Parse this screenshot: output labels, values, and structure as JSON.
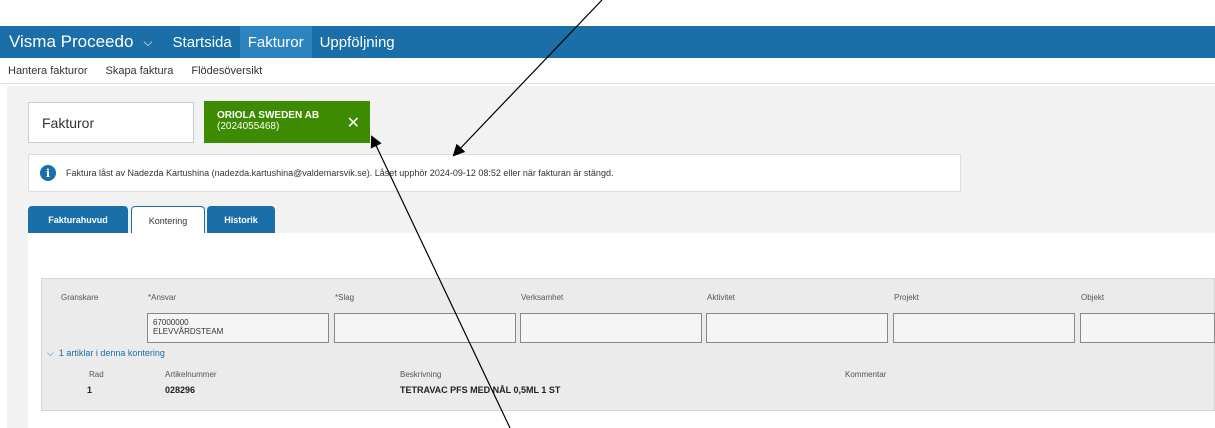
{
  "header": {
    "app_name": "Visma Proceedo",
    "nav": [
      "Startsida",
      "Fakturor",
      "Uppföljning"
    ]
  },
  "subnav": [
    "Hantera fakturor",
    "Skapa faktura",
    "Flödesöversikt"
  ],
  "invoice_box": {
    "label": "Fakturor"
  },
  "supplier_tag": {
    "name": "ORIOLA SWEDEN AB",
    "number": "(2024055468)"
  },
  "info_message": "Faktura låst av Nadezda Kartushina (nadezda.kartushina@valdemarsvik.se). Låset upphör 2024-09-12 08:52 eller när fakturan är stängd.",
  "tabs": [
    "Fakturahuvud",
    "Kontering",
    "Historik"
  ],
  "kontering": {
    "columns": [
      "Granskare",
      "*Ansvar",
      "*Slag",
      "Verksamhet",
      "Aktivitet",
      "Projekt",
      "Objekt"
    ],
    "ansvar_code": "67000000",
    "ansvar_name": "ELEVVÅRDSTEAM",
    "expand_label": "1 artiklar i denna kontering"
  },
  "article": {
    "headers": [
      "Rad",
      "Artikelnummer",
      "Beskrivning",
      "Kommentar"
    ],
    "row": "1",
    "number": "028296",
    "description": "TETRAVAC PFS MED NÅL 0,5ML 1 ST"
  },
  "colors": {
    "header": "#1a6fa8",
    "tag": "#3d8b00"
  }
}
